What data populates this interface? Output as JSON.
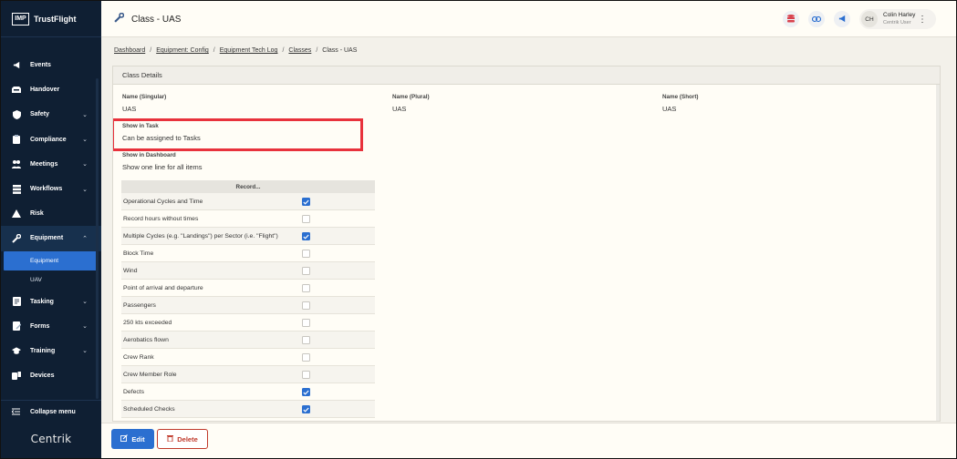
{
  "brand": {
    "logo": "IMP",
    "name": "TrustFlight"
  },
  "sidebar": {
    "items": [
      {
        "label": "Events",
        "icon": "megaphone-icon",
        "has_chevron": false
      },
      {
        "label": "Handover",
        "icon": "inbox-icon",
        "has_chevron": false
      },
      {
        "label": "Safety",
        "icon": "shield-icon",
        "has_chevron": true
      },
      {
        "label": "Compliance",
        "icon": "clipboard-icon",
        "has_chevron": true
      },
      {
        "label": "Meetings",
        "icon": "people-icon",
        "has_chevron": true
      },
      {
        "label": "Workflows",
        "icon": "stack-icon",
        "has_chevron": true
      },
      {
        "label": "Risk",
        "icon": "warning-icon",
        "has_chevron": false
      },
      {
        "label": "Equipment",
        "icon": "wrench-icon",
        "has_chevron": true,
        "expanded": true
      }
    ],
    "sub_items": [
      {
        "label": "Equipment",
        "selected": true
      },
      {
        "label": "UAV",
        "selected": false
      }
    ],
    "items_after": [
      {
        "label": "Tasking",
        "icon": "tasks-icon",
        "has_chevron": true
      },
      {
        "label": "Forms",
        "icon": "form-icon",
        "has_chevron": true
      },
      {
        "label": "Training",
        "icon": "graduation-icon",
        "has_chevron": true
      },
      {
        "label": "Devices",
        "icon": "devices-icon",
        "has_chevron": false
      }
    ],
    "collapse_label": "Collapse menu",
    "footer_logo": "Centrik"
  },
  "header": {
    "title": "Class - UAS",
    "user": {
      "initials": "CH",
      "name": "Colin Harley",
      "role": "Centrik User"
    }
  },
  "breadcrumb": [
    "Dashboard",
    "Equipment: Config",
    "Equipment Tech Log",
    "Classes",
    "Class - UAS"
  ],
  "details": {
    "header": "Class Details",
    "name_singular": {
      "label": "Name (Singular)",
      "value": "UAS"
    },
    "name_plural": {
      "label": "Name (Plural)",
      "value": "UAS"
    },
    "name_short": {
      "label": "Name (Short)",
      "value": "UAS"
    },
    "show_in_task": {
      "label": "Show in Task",
      "value": "Can be assigned to Tasks"
    },
    "show_in_dashboard": {
      "label": "Show in Dashboard",
      "value": "Show one line for all items"
    },
    "record_header": "Record...",
    "record_rows": [
      {
        "label": "Operational Cycles and Time",
        "checked": true
      },
      {
        "label": "Record hours without times",
        "checked": false
      },
      {
        "label": "Multiple Cycles (e.g. \"Landings\") per Sector (i.e. \"Flight\")",
        "checked": true
      },
      {
        "label": "Block Time",
        "checked": false
      },
      {
        "label": "Wind",
        "checked": false
      },
      {
        "label": "Point of arrival and departure",
        "checked": false
      },
      {
        "label": "Passengers",
        "checked": false
      },
      {
        "label": "250 kts exceeded",
        "checked": false
      },
      {
        "label": "Aerobatics flown",
        "checked": false
      },
      {
        "label": "Crew Rank",
        "checked": false
      },
      {
        "label": "Crew Member Role",
        "checked": false
      },
      {
        "label": "Defects",
        "checked": true
      },
      {
        "label": "Scheduled Checks",
        "checked": true
      }
    ]
  },
  "footer": {
    "edit_label": "Edit",
    "delete_label": "Delete"
  },
  "colors": {
    "sidebar_bg": "#0f1f33",
    "accent": "#2b6fd0",
    "danger": "#c0392b",
    "highlight": "#e8323c"
  }
}
